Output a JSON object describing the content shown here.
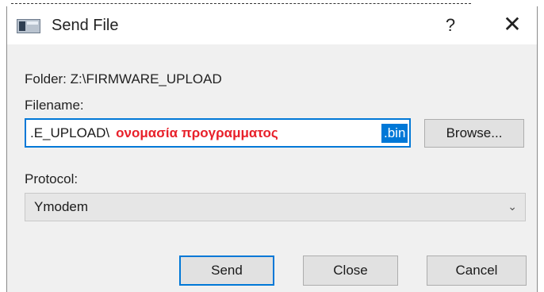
{
  "window": {
    "title": "Send File",
    "help_label": "?",
    "close_glyph": "✕",
    "icon": "app-window-icon"
  },
  "top_strip": {
    "tick_glyph": "ٟ"
  },
  "folder": {
    "label": "Folder:",
    "path": "Z:\\FIRMWARE_UPLOAD"
  },
  "filename": {
    "label": "Filename:",
    "value_prefix": ".E_UPLOAD\\",
    "annotation": "ονομασία προγραμματος",
    "selected_text": ".bin",
    "annotation_color": "#e8202a",
    "selection_color": "#0078d7"
  },
  "browse": {
    "label": "Browse..."
  },
  "protocol": {
    "label": "Protocol:",
    "selected": "Ymodem",
    "chevron_icon": "chevron-down-icon"
  },
  "buttons": {
    "send": "Send",
    "close": "Close",
    "cancel": "Cancel"
  },
  "colors": {
    "accent": "#0078d7",
    "dialog_bg": "#f0f0f0",
    "button_bg": "#e1e1e1"
  }
}
